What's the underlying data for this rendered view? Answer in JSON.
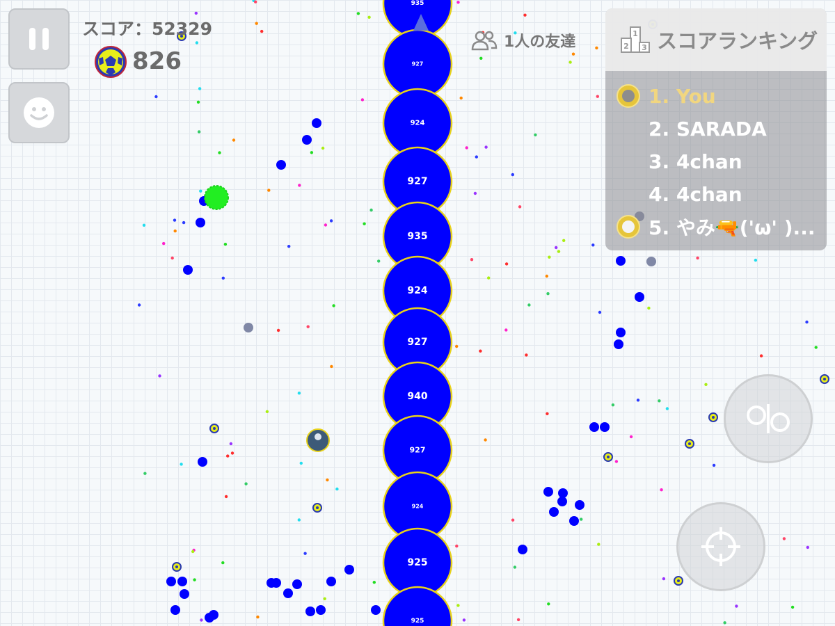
{
  "hud": {
    "score_text": "スコア：52329",
    "mass_value": "826",
    "friends_text": "1人の友達"
  },
  "leaderboard": {
    "title": "スコアランキング",
    "entries": [
      {
        "rank_text": "1. You",
        "is_self": true
      },
      {
        "rank_text": "2. SARADA",
        "is_self": false
      },
      {
        "rank_text": "3. 4chan",
        "is_self": false
      },
      {
        "rank_text": "4. 4chan",
        "is_self": false
      },
      {
        "rank_text": "5. やみ🔫('ω' )...",
        "is_self": false
      }
    ]
  },
  "cells": [
    {
      "label": "935"
    },
    {
      "label": "927"
    },
    {
      "label": "924"
    },
    {
      "label": "927"
    },
    {
      "label": "935"
    },
    {
      "label": "924"
    },
    {
      "label": "927"
    },
    {
      "label": "940"
    },
    {
      "label": "927"
    },
    {
      "label": "924"
    },
    {
      "label": "925"
    },
    {
      "label": "925"
    }
  ],
  "icons": {
    "pause": "pause-icon",
    "emoji": "smiley-icon",
    "friends": "friends-icon",
    "ranking": "ranking-icon",
    "split": "split-icon",
    "eject": "crosshair-icon",
    "skin": "soccer-ball-icon"
  },
  "colors": {
    "cell_fill": "#0000ff",
    "cell_border": "#e8d21a",
    "self_highlight": "#f1d680",
    "virus": "#22ee22"
  }
}
